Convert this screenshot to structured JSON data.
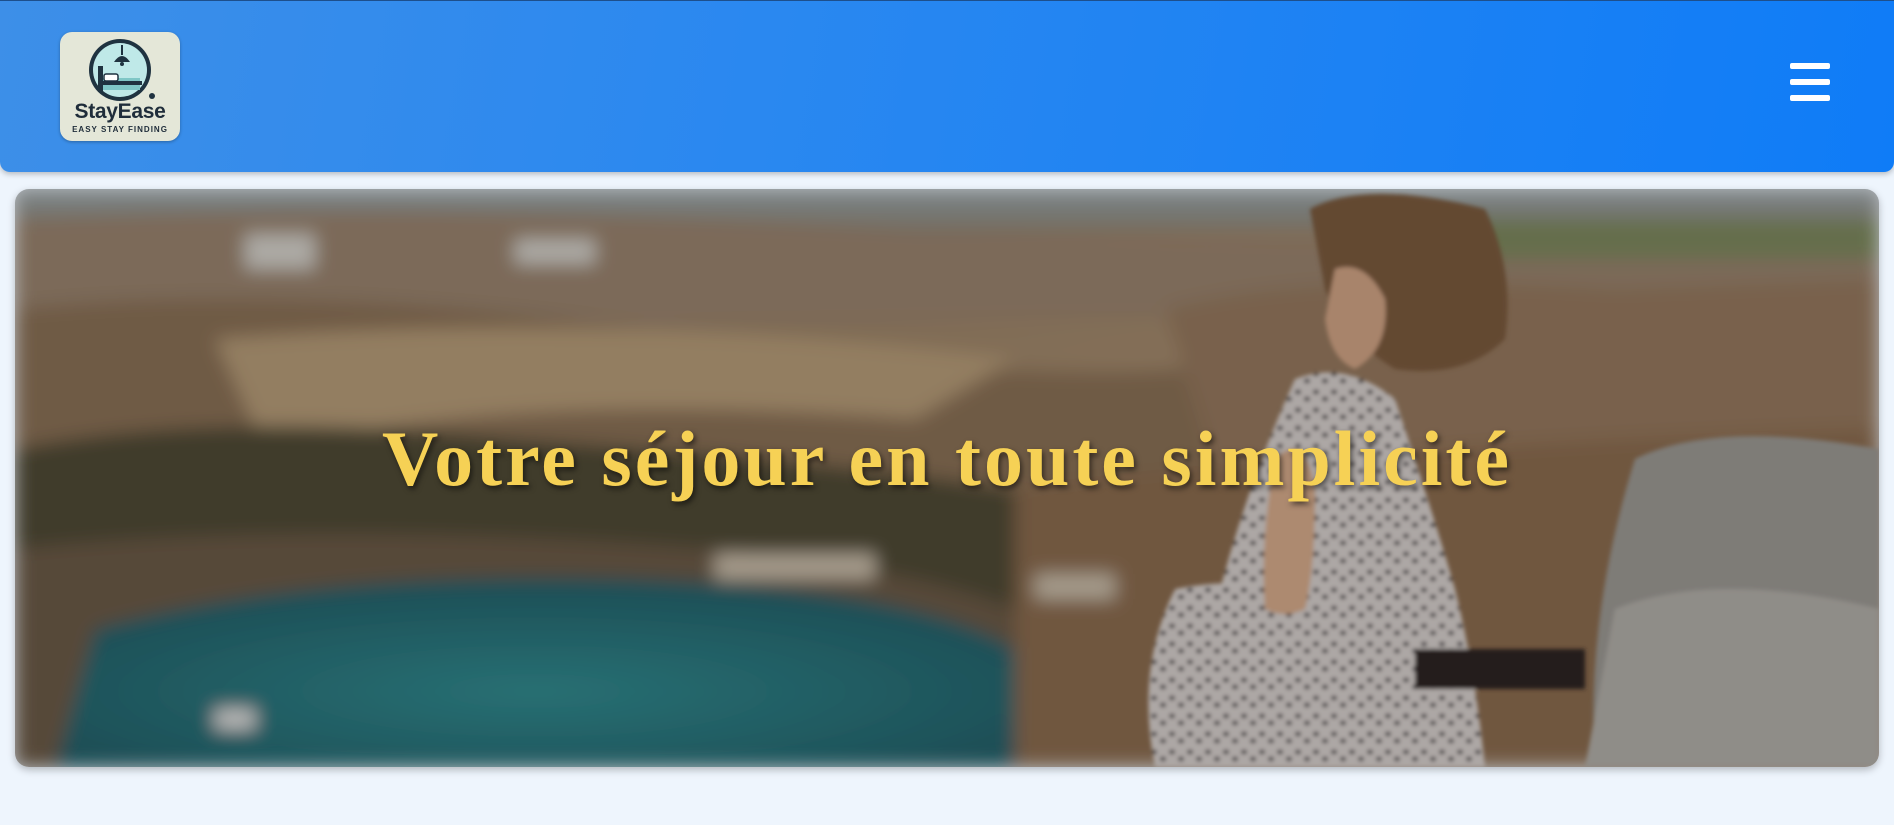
{
  "header": {
    "logo": {
      "name": "StayEase",
      "tagline": "EASY STAY FINDING",
      "icon": "bed-lamp-logo-icon"
    },
    "menu_icon": "hamburger-menu-icon",
    "colors": {
      "bar_start": "#3d8fe8",
      "bar_end": "#0f7cf7"
    }
  },
  "hero": {
    "title": "Votre séjour en toute simplicité",
    "image": "woman-overlooking-coastal-bay-photo",
    "title_color": "#f6d155"
  }
}
